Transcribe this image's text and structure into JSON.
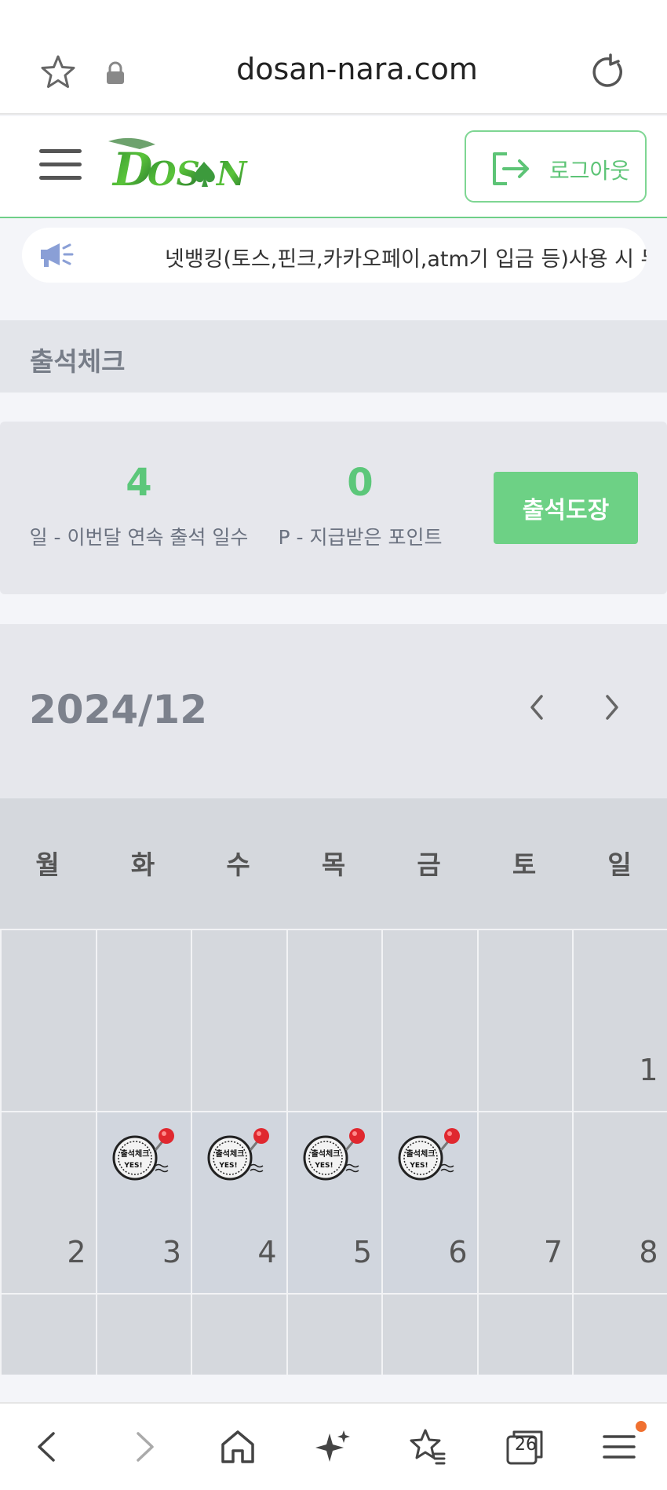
{
  "browser": {
    "url": "dosan-nara.com",
    "tabs_count": "26"
  },
  "header": {
    "logo_text": "DOSAN",
    "logout_label": "로그아웃"
  },
  "notice": {
    "text": "넷뱅킹(토스,핀크,카카오페이,atm기 입금 등)사용 시 무조건"
  },
  "page_title": "출석체크",
  "stats": {
    "streak_value": "4",
    "streak_caption": "일 - 이번달 연속 출석 일수",
    "points_value": "0",
    "points_caption": "P - 지급받은 포인트",
    "attend_button": "출석도장"
  },
  "calendar": {
    "month": "2024/12",
    "weekdays": [
      "월",
      "화",
      "수",
      "목",
      "금",
      "토",
      "일"
    ],
    "week1": [
      "",
      "",
      "",
      "",
      "",
      "",
      "1"
    ],
    "week2": [
      "2",
      "3",
      "4",
      "5",
      "6",
      "7",
      "8"
    ],
    "stamp_text_top": "출석체크",
    "stamp_text_bottom": "YES!",
    "stamped_days": [
      "3",
      "4",
      "5",
      "6"
    ]
  },
  "colors": {
    "accent_green": "#6dd185",
    "stat_green": "#5cc77a",
    "notification_dot": "#f07030"
  },
  "icons": {
    "browser_top": [
      "star-icon",
      "lock-icon",
      "reload-icon"
    ],
    "browser_bottom": [
      "back-icon",
      "forward-icon",
      "home-icon",
      "sparkle-icon",
      "bookmarks-icon",
      "tabs-icon",
      "menu-icon"
    ]
  }
}
